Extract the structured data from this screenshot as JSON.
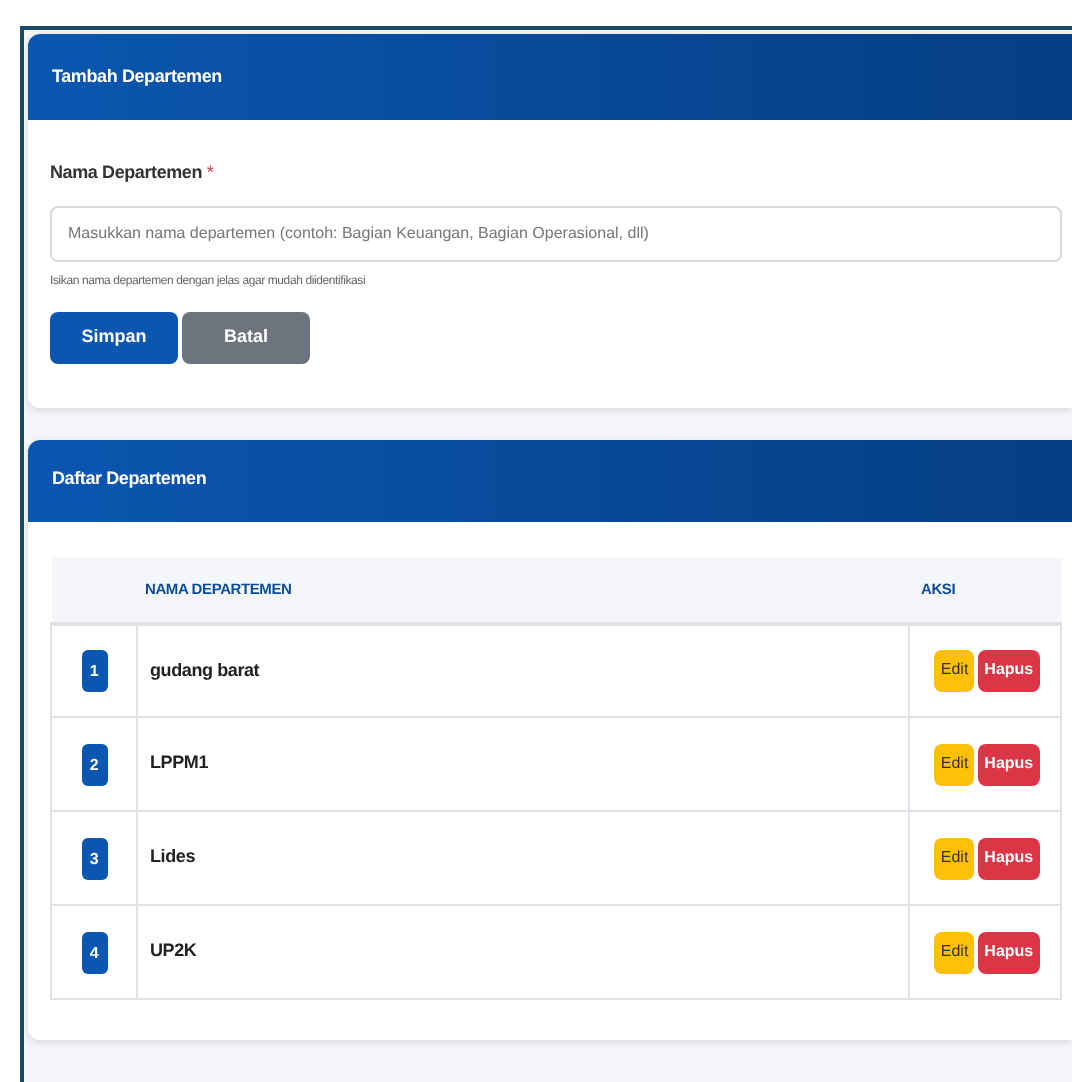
{
  "form_card": {
    "title": "Tambah Departemen",
    "label": "Nama Departemen",
    "required_mark": "*",
    "placeholder": "Masukkan nama departemen (contoh: Bagian Keuangan, Bagian Operasional, dll)",
    "help": "Isikan nama departemen dengan jelas agar mudah diidentifikasi",
    "buttons": [
      {
        "label": "Simpan",
        "kind": "primary"
      },
      {
        "label": "Batal",
        "kind": "secondary"
      }
    ]
  },
  "list_card": {
    "title": "Daftar Departemen",
    "table": {
      "columns": [
        "NAMA DEPARTEMEN",
        "AKSI"
      ],
      "rows": [
        {
          "number": "1",
          "name": "gudang barat",
          "actions": [
            {
              "label": "Edit",
              "kind": "edit"
            },
            {
              "label": "Hapus",
              "kind": "delete"
            }
          ]
        },
        {
          "number": "2",
          "name": "LPPM1",
          "actions": [
            {
              "label": "Edit",
              "kind": "edit"
            },
            {
              "label": "Hapus",
              "kind": "delete"
            }
          ]
        },
        {
          "number": "3",
          "name": "Lides",
          "actions": [
            {
              "label": "Edit",
              "kind": "edit"
            },
            {
              "label": "Hapus",
              "kind": "delete"
            }
          ]
        },
        {
          "number": "4",
          "name": "UP2K",
          "actions": [
            {
              "label": "Edit",
              "kind": "edit"
            },
            {
              "label": "Hapus",
              "kind": "delete"
            }
          ]
        }
      ]
    }
  }
}
